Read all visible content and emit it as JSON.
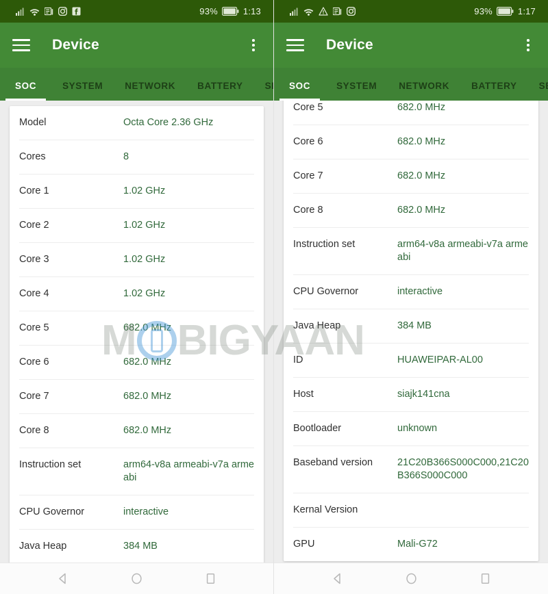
{
  "left_phone": {
    "statusbar": {
      "icons": [
        "signal-bars-icon",
        "wifi-icon",
        "news-app-icon",
        "instagram-icon",
        "facebook-icon"
      ],
      "battery_percent": "93%",
      "time": "1:13"
    },
    "appbar": {
      "menu_icon": "hamburger-menu-icon",
      "title": "Device",
      "overflow_icon": "kebab-menu-icon"
    },
    "tabs": [
      {
        "label": "SOC",
        "active": true
      },
      {
        "label": "SYSTEM",
        "active": false
      },
      {
        "label": "NETWORK",
        "active": false
      },
      {
        "label": "BATTERY",
        "active": false
      },
      {
        "label": "SE",
        "active": false
      }
    ],
    "rows": [
      {
        "label": "Model",
        "value": "Octa Core 2.36 GHz"
      },
      {
        "label": "Cores",
        "value": "8"
      },
      {
        "label": "Core 1",
        "value": "1.02 GHz"
      },
      {
        "label": "Core 2",
        "value": "1.02 GHz"
      },
      {
        "label": "Core 3",
        "value": "1.02 GHz"
      },
      {
        "label": "Core 4",
        "value": "1.02 GHz"
      },
      {
        "label": "Core 5",
        "value": "682.0 MHz"
      },
      {
        "label": "Core 6",
        "value": "682.0 MHz"
      },
      {
        "label": "Core 7",
        "value": "682.0 MHz"
      },
      {
        "label": "Core 8",
        "value": "682.0 MHz"
      },
      {
        "label": "Instruction set",
        "value": "arm64-v8a armeabi-v7a armeabi"
      },
      {
        "label": "CPU Governor",
        "value": "interactive"
      },
      {
        "label": "Java Heap",
        "value": "384 MB"
      }
    ],
    "navbar": [
      "back-icon",
      "home-icon",
      "recents-icon"
    ]
  },
  "right_phone": {
    "statusbar": {
      "icons": [
        "signal-bars-icon",
        "wifi-icon",
        "warning-triangle-icon",
        "news-app-icon",
        "instagram-icon"
      ],
      "battery_percent": "93%",
      "time": "1:17"
    },
    "appbar": {
      "menu_icon": "hamburger-menu-icon",
      "title": "Device",
      "overflow_icon": "kebab-menu-icon"
    },
    "tabs": [
      {
        "label": "SOC",
        "active": true
      },
      {
        "label": "SYSTEM",
        "active": false
      },
      {
        "label": "NETWORK",
        "active": false
      },
      {
        "label": "BATTERY",
        "active": false
      },
      {
        "label": "SE",
        "active": false
      }
    ],
    "rows": [
      {
        "label": "Core 5",
        "value": "682.0 MHz"
      },
      {
        "label": "Core 6",
        "value": "682.0 MHz"
      },
      {
        "label": "Core 7",
        "value": "682.0 MHz"
      },
      {
        "label": "Core 8",
        "value": "682.0 MHz"
      },
      {
        "label": "Instruction set",
        "value": "arm64-v8a armeabi-v7a armeabi"
      },
      {
        "label": "CPU Governor",
        "value": "interactive"
      },
      {
        "label": "Java Heap",
        "value": "384 MB"
      },
      {
        "label": "ID",
        "value": "HUAWEIPAR-AL00"
      },
      {
        "label": "Host",
        "value": "siajk141cna"
      },
      {
        "label": "Bootloader",
        "value": "unknown"
      },
      {
        "label": "Baseband version",
        "value": "21C20B366S000C000,21C20B366S000C000"
      },
      {
        "label": "Kernal Version",
        "value": ""
      },
      {
        "label": "GPU",
        "value": "Mali-G72"
      }
    ],
    "navbar": [
      "back-icon",
      "home-icon",
      "recents-icon"
    ]
  },
  "watermark": {
    "text_before": "M",
    "logo": "mobigyaan-logo-icon",
    "text_after": "BIGYAAN"
  },
  "colors": {
    "statusbar_green": "#2d5908",
    "appbar_green": "#438a36",
    "tabbar_green": "#3f8235",
    "value_green": "#31693b",
    "label_gray": "#303030"
  }
}
